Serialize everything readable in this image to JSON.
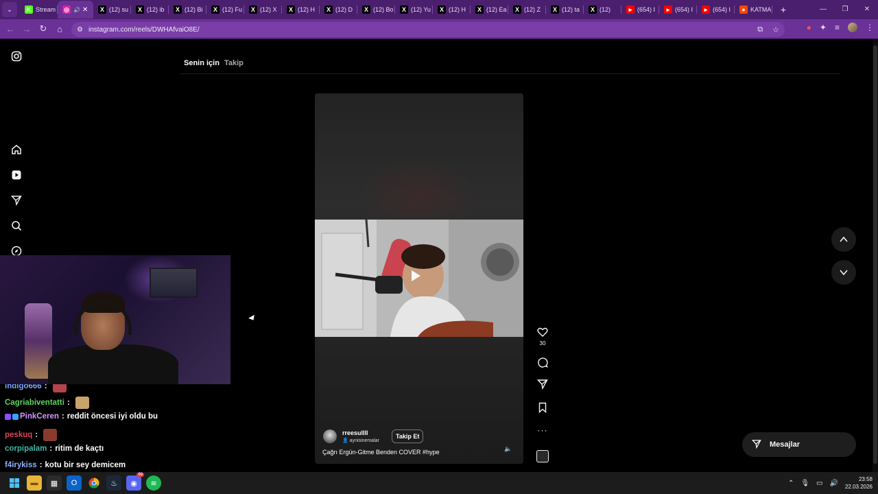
{
  "browser": {
    "tabs": [
      {
        "title": "Stream",
        "favicon": "kick-icon",
        "fav_color": "#53fc18",
        "fav_glyph": "K",
        "active": false
      },
      {
        "title": "",
        "favicon": "instagram-icon",
        "fav_color": "#d6249f",
        "fav_glyph": "◎",
        "active": true
      },
      {
        "title": "(12) su",
        "favicon": "x-icon",
        "fav_color": "#000000",
        "fav_glyph": "X",
        "active": false
      },
      {
        "title": "(12) ib",
        "favicon": "x-icon",
        "fav_color": "#000000",
        "fav_glyph": "X",
        "active": false
      },
      {
        "title": "(12) Bi",
        "favicon": "x-icon",
        "fav_color": "#000000",
        "fav_glyph": "X",
        "active": false
      },
      {
        "title": "(12) Fu",
        "favicon": "x-icon",
        "fav_color": "#000000",
        "fav_glyph": "X",
        "active": false
      },
      {
        "title": "(12) X",
        "favicon": "x-icon",
        "fav_color": "#000000",
        "fav_glyph": "X",
        "active": false
      },
      {
        "title": "(12) H",
        "favicon": "x-icon",
        "fav_color": "#000000",
        "fav_glyph": "X",
        "active": false
      },
      {
        "title": "(12) D",
        "favicon": "x-icon",
        "fav_color": "#000000",
        "fav_glyph": "X",
        "active": false
      },
      {
        "title": "(12) Bo",
        "favicon": "x-icon",
        "fav_color": "#000000",
        "fav_glyph": "X",
        "active": false
      },
      {
        "title": "(12) Yu",
        "favicon": "x-icon",
        "fav_color": "#000000",
        "fav_glyph": "X",
        "active": false
      },
      {
        "title": "(12) H",
        "favicon": "x-icon",
        "fav_color": "#000000",
        "fav_glyph": "X",
        "active": false
      },
      {
        "title": "(12) Ea",
        "favicon": "x-icon",
        "fav_color": "#000000",
        "fav_glyph": "X",
        "active": false
      },
      {
        "title": "(12) Z",
        "favicon": "x-icon",
        "fav_color": "#000000",
        "fav_glyph": "X",
        "active": false
      },
      {
        "title": "(12) ta",
        "favicon": "x-icon",
        "fav_color": "#000000",
        "fav_glyph": "X",
        "active": false
      },
      {
        "title": "(12)",
        "favicon": "x-icon",
        "fav_color": "#000000",
        "fav_glyph": "X",
        "active": false
      },
      {
        "title": "(654) I",
        "favicon": "youtube-icon",
        "fav_color": "#ff0000",
        "fav_glyph": "▸",
        "active": false
      },
      {
        "title": "(654) I",
        "favicon": "youtube-icon",
        "fav_color": "#ff0000",
        "fav_glyph": "▸",
        "active": false
      },
      {
        "title": "(654) I",
        "favicon": "youtube-icon",
        "fav_color": "#ff0000",
        "fav_glyph": "▸",
        "active": false
      },
      {
        "title": "KATMA",
        "favicon": "reddit-icon",
        "fav_color": "#ff4500",
        "fav_glyph": "●",
        "active": false
      }
    ],
    "url": "instagram.com/reels/DWHAfvaiO8E/"
  },
  "instagram": {
    "feed_tabs": {
      "for_you": "Senin için",
      "following": "Takip"
    },
    "reel": {
      "username": "rreesullll",
      "audio": "aynisinemalar",
      "follow_label": "Takip Et",
      "caption": "Çağrı Ergün-Gitme Benden COVER #hype",
      "like_count": "30"
    },
    "messages_label": "Mesajlar"
  },
  "stream_chat": [
    {
      "user": "indigo666",
      "user_color": "#7aa7ff",
      "sep": ":",
      "text": "",
      "emote": true,
      "emote_color": "#b5434a"
    },
    {
      "user": "Cagriabiventatti",
      "user_color": "#5fd35f",
      "sep": ":",
      "text": "",
      "emote": true,
      "emote_color": "#c9a36b"
    },
    {
      "user": "PinkCeren",
      "user_color": "#d09cff",
      "sep": ":",
      "text": "reddit öncesi iyi oldu bu",
      "emote": false,
      "badges": true
    },
    {
      "user": "peskuq",
      "user_color": "#e0435a",
      "sep": ":",
      "text": "",
      "emote": true,
      "emote_color": "#8a3b2d"
    },
    {
      "user": "corpipalam",
      "user_color": "#3fb6a8",
      "sep": ":",
      "text": "ritim de kaçtı",
      "emote": false
    },
    {
      "user": "f4irykiss",
      "user_color": "#8fb0ff",
      "sep": ":",
      "text": "kotu bir sey demicem",
      "emote": false
    }
  ],
  "taskbar": {
    "time": "23:58",
    "date": "22.03.2026",
    "discord_badge": "99"
  }
}
